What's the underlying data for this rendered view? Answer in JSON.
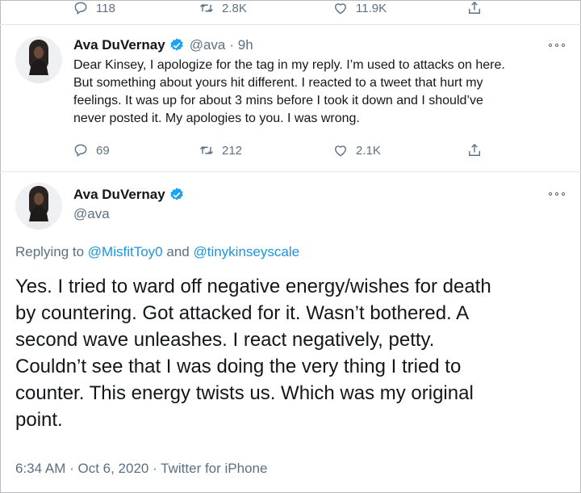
{
  "prev_tweet_actions": {
    "reply_count": "118",
    "retweet_count": "2.8K",
    "like_count": "11.9K"
  },
  "reply_tweet": {
    "author_name": "Ava DuVernay",
    "handle": "@ava",
    "time": "· 9h",
    "text": "Dear Kinsey, I apologize for the tag in my reply. I’m used to attacks on here.\nBut something about yours hit different. I reacted to a tweet that hurt my\nfeelings. It was up for about 3 mins before I took it down and I should’ve\nnever posted it. My apologies to you. I was wrong.",
    "reply_count": "69",
    "retweet_count": "212",
    "like_count": "2.1K"
  },
  "main_tweet": {
    "author_name": "Ava DuVernay",
    "handle": "@ava",
    "replying_to_prefix": "Replying to",
    "mention_1": "@MisfitToy0",
    "and_word": "and",
    "mention_2": "@tinykinseyscale",
    "text": "Yes. I tried to ward off negative energy/wishes for death\nby countering. Got attacked for it. Wasn’t bothered. A\nsecond wave unleashes. I react negatively, petty.\nCouldn’t see that I was doing the very thing I tried to\ncounter. This energy twists us. Which was my original\npoint.",
    "timestamp": "6:34 AM · Oct 6, 2020 · Twitter for iPhone"
  },
  "colors": {
    "icon_gray": "#5b7083",
    "link_blue": "#1b95e0",
    "verified_blue": "#1da1f2",
    "text_dark": "#14171a"
  },
  "icons": [
    "reply-icon",
    "retweet-icon",
    "like-icon",
    "share-icon",
    "verified-badge-icon",
    "more-options-icon"
  ]
}
